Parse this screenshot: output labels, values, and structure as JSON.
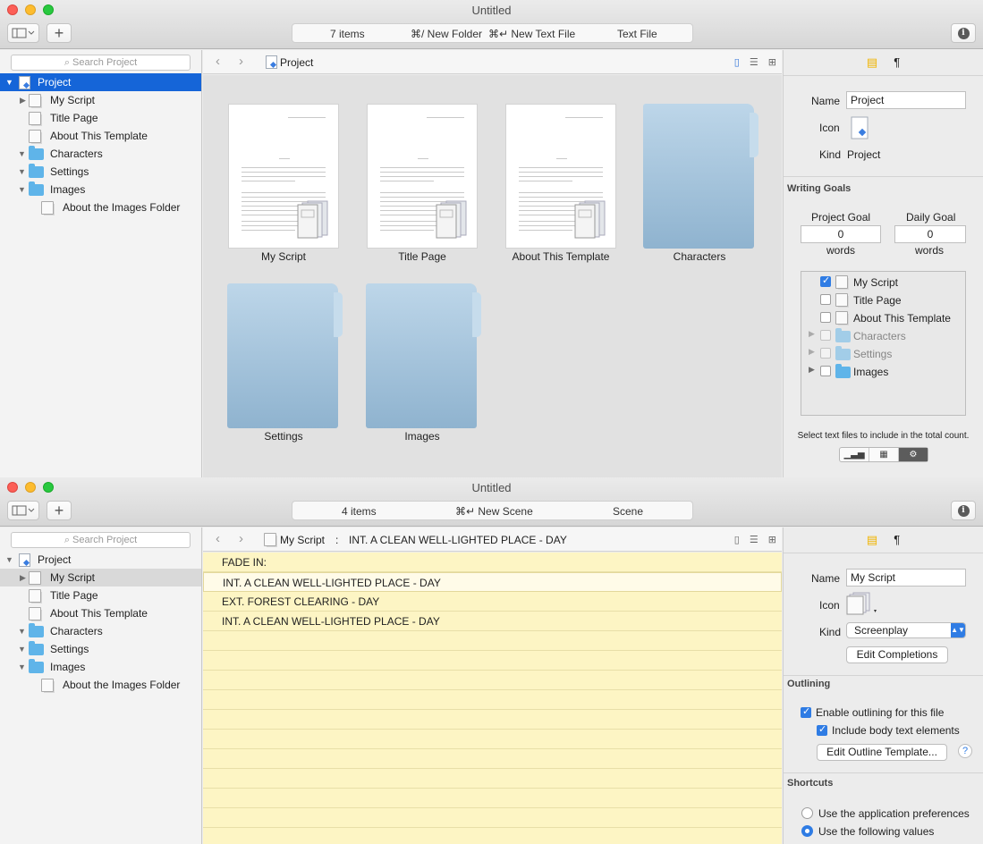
{
  "window1": {
    "title": "Untitled",
    "status": {
      "count": "7 items",
      "new_folder": "⌘/ New Folder",
      "new_text_file": "⌘↵ New Text File",
      "file_type": "Text File"
    },
    "search_placeholder": "Search Project",
    "tree": [
      {
        "label": "Project",
        "type": "project",
        "arrow": "▼"
      },
      {
        "label": "My Script",
        "type": "doc",
        "arrow": "▶"
      },
      {
        "label": "Title Page",
        "type": "doc",
        "arrow": ""
      },
      {
        "label": "About This Template",
        "type": "doc",
        "arrow": ""
      },
      {
        "label": "Characters",
        "type": "folder",
        "arrow": "▼"
      },
      {
        "label": "Settings",
        "type": "folder",
        "arrow": "▼"
      },
      {
        "label": "Images",
        "type": "folder",
        "arrow": "▼"
      },
      {
        "label": "About the Images Folder",
        "type": "doc",
        "arrow": ""
      }
    ],
    "path": {
      "crumb": "Project"
    },
    "tiles": [
      {
        "label": "My Script",
        "type": "page"
      },
      {
        "label": "Title Page",
        "type": "page"
      },
      {
        "label": "About This Template",
        "type": "page"
      },
      {
        "label": "Characters",
        "type": "folder"
      },
      {
        "label": "Settings",
        "type": "folder"
      },
      {
        "label": "Images",
        "type": "folder"
      }
    ],
    "inspector": {
      "name_label": "Name",
      "name_value": "Project",
      "icon_label": "Icon",
      "kind_label": "Kind",
      "kind_value": "Project",
      "writing_goals": "Writing Goals",
      "project_goal": "Project Goal",
      "daily_goal": "Daily Goal",
      "project_goal_value": "0",
      "daily_goal_value": "0",
      "words": "words",
      "goal_items": [
        {
          "label": "My Script",
          "checked": true,
          "dim": false,
          "type": "doc"
        },
        {
          "label": "Title Page",
          "checked": false,
          "dim": false,
          "type": "doc"
        },
        {
          "label": "About This Template",
          "checked": false,
          "dim": false,
          "type": "doc"
        },
        {
          "label": "Characters",
          "checked": false,
          "dim": true,
          "type": "folder"
        },
        {
          "label": "Settings",
          "checked": false,
          "dim": true,
          "type": "folder"
        },
        {
          "label": "Images",
          "checked": false,
          "dim": false,
          "type": "folder"
        }
      ],
      "hint": "Select text files to include in the total count."
    }
  },
  "window2": {
    "title": "Untitled",
    "status": {
      "count": "4 items",
      "new_scene": "⌘↵ New Scene",
      "element": "Scene"
    },
    "search_placeholder": "Search Project",
    "tree": [
      {
        "label": "Project",
        "type": "project",
        "arrow": "▼"
      },
      {
        "label": "My Script",
        "type": "doc",
        "arrow": "▶"
      },
      {
        "label": "Title Page",
        "type": "doc",
        "arrow": ""
      },
      {
        "label": "About This Template",
        "type": "doc",
        "arrow": ""
      },
      {
        "label": "Characters",
        "type": "folder",
        "arrow": "▼"
      },
      {
        "label": "Settings",
        "type": "folder",
        "arrow": "▼"
      },
      {
        "label": "Images",
        "type": "folder",
        "arrow": "▼"
      },
      {
        "label": "About the Images Folder",
        "type": "doc",
        "arrow": ""
      }
    ],
    "path": {
      "crumb": "My Script",
      "sep": ":",
      "scene": "INT. A CLEAN WELL-LIGHTED PLACE - DAY"
    },
    "lines": [
      "FADE IN:",
      "INT. A CLEAN WELL-LIGHTED PLACE - DAY",
      "EXT. FOREST CLEARING - DAY",
      "INT. A CLEAN WELL-LIGHTED PLACE - DAY"
    ],
    "inspector": {
      "name_label": "Name",
      "name_value": "My Script",
      "icon_label": "Icon",
      "kind_label": "Kind",
      "kind_value": "Screenplay",
      "edit_completions": "Edit Completions",
      "outlining": "Outlining",
      "enable_outlining": "Enable outlining for this file",
      "include_body": "Include body text elements",
      "edit_outline_template": "Edit Outline Template...",
      "shortcuts": "Shortcuts",
      "use_app_prefs": "Use the application preferences",
      "use_following": "Use the following values"
    }
  }
}
